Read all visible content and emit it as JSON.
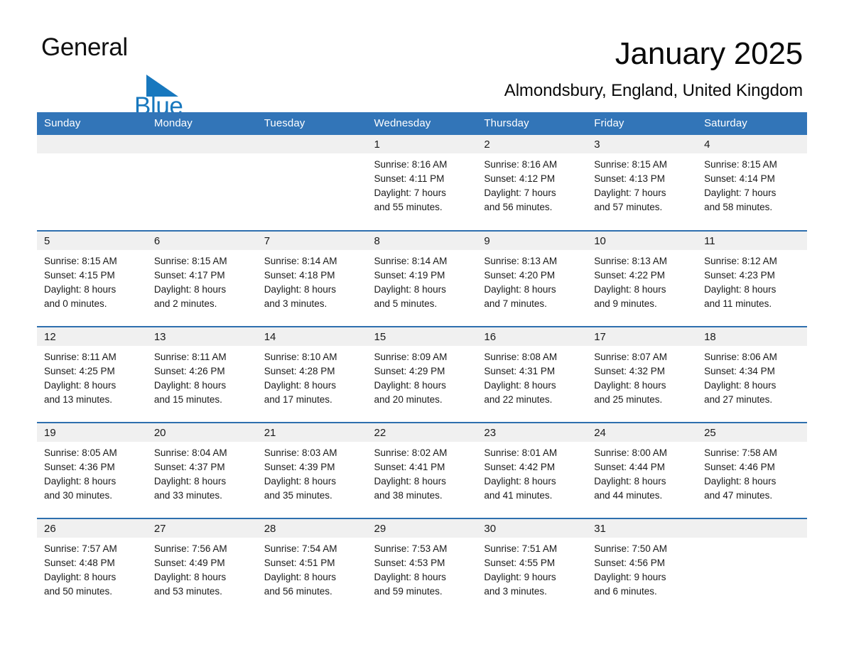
{
  "brand": {
    "name_part1": "General",
    "name_part2": "Blue",
    "triangle_color": "#1878BE",
    "text_color": "#101010"
  },
  "header": {
    "month_title": "January 2025",
    "location": "Almondsbury, England, United Kingdom"
  },
  "theme": {
    "header_blue": "#3275B8",
    "row_divider_blue": "#2E6FAE",
    "daynum_band_gray": "#F0F0F0",
    "text_color": "#1a1a1a"
  },
  "weekday_headers": [
    "Sunday",
    "Monday",
    "Tuesday",
    "Wednesday",
    "Thursday",
    "Friday",
    "Saturday"
  ],
  "weeks": [
    [
      {
        "day": "",
        "blank": true,
        "sunrise": "",
        "sunset": "",
        "daylight_line1": "",
        "daylight_line2": ""
      },
      {
        "day": "",
        "blank": true,
        "sunrise": "",
        "sunset": "",
        "daylight_line1": "",
        "daylight_line2": ""
      },
      {
        "day": "",
        "blank": true,
        "sunrise": "",
        "sunset": "",
        "daylight_line1": "",
        "daylight_line2": ""
      },
      {
        "day": "1",
        "blank": false,
        "sunrise": "Sunrise: 8:16 AM",
        "sunset": "Sunset: 4:11 PM",
        "daylight_line1": "Daylight: 7 hours",
        "daylight_line2": "and 55 minutes."
      },
      {
        "day": "2",
        "blank": false,
        "sunrise": "Sunrise: 8:16 AM",
        "sunset": "Sunset: 4:12 PM",
        "daylight_line1": "Daylight: 7 hours",
        "daylight_line2": "and 56 minutes."
      },
      {
        "day": "3",
        "blank": false,
        "sunrise": "Sunrise: 8:15 AM",
        "sunset": "Sunset: 4:13 PM",
        "daylight_line1": "Daylight: 7 hours",
        "daylight_line2": "and 57 minutes."
      },
      {
        "day": "4",
        "blank": false,
        "sunrise": "Sunrise: 8:15 AM",
        "sunset": "Sunset: 4:14 PM",
        "daylight_line1": "Daylight: 7 hours",
        "daylight_line2": "and 58 minutes."
      }
    ],
    [
      {
        "day": "5",
        "blank": false,
        "sunrise": "Sunrise: 8:15 AM",
        "sunset": "Sunset: 4:15 PM",
        "daylight_line1": "Daylight: 8 hours",
        "daylight_line2": "and 0 minutes."
      },
      {
        "day": "6",
        "blank": false,
        "sunrise": "Sunrise: 8:15 AM",
        "sunset": "Sunset: 4:17 PM",
        "daylight_line1": "Daylight: 8 hours",
        "daylight_line2": "and 2 minutes."
      },
      {
        "day": "7",
        "blank": false,
        "sunrise": "Sunrise: 8:14 AM",
        "sunset": "Sunset: 4:18 PM",
        "daylight_line1": "Daylight: 8 hours",
        "daylight_line2": "and 3 minutes."
      },
      {
        "day": "8",
        "blank": false,
        "sunrise": "Sunrise: 8:14 AM",
        "sunset": "Sunset: 4:19 PM",
        "daylight_line1": "Daylight: 8 hours",
        "daylight_line2": "and 5 minutes."
      },
      {
        "day": "9",
        "blank": false,
        "sunrise": "Sunrise: 8:13 AM",
        "sunset": "Sunset: 4:20 PM",
        "daylight_line1": "Daylight: 8 hours",
        "daylight_line2": "and 7 minutes."
      },
      {
        "day": "10",
        "blank": false,
        "sunrise": "Sunrise: 8:13 AM",
        "sunset": "Sunset: 4:22 PM",
        "daylight_line1": "Daylight: 8 hours",
        "daylight_line2": "and 9 minutes."
      },
      {
        "day": "11",
        "blank": false,
        "sunrise": "Sunrise: 8:12 AM",
        "sunset": "Sunset: 4:23 PM",
        "daylight_line1": "Daylight: 8 hours",
        "daylight_line2": "and 11 minutes."
      }
    ],
    [
      {
        "day": "12",
        "blank": false,
        "sunrise": "Sunrise: 8:11 AM",
        "sunset": "Sunset: 4:25 PM",
        "daylight_line1": "Daylight: 8 hours",
        "daylight_line2": "and 13 minutes."
      },
      {
        "day": "13",
        "blank": false,
        "sunrise": "Sunrise: 8:11 AM",
        "sunset": "Sunset: 4:26 PM",
        "daylight_line1": "Daylight: 8 hours",
        "daylight_line2": "and 15 minutes."
      },
      {
        "day": "14",
        "blank": false,
        "sunrise": "Sunrise: 8:10 AM",
        "sunset": "Sunset: 4:28 PM",
        "daylight_line1": "Daylight: 8 hours",
        "daylight_line2": "and 17 minutes."
      },
      {
        "day": "15",
        "blank": false,
        "sunrise": "Sunrise: 8:09 AM",
        "sunset": "Sunset: 4:29 PM",
        "daylight_line1": "Daylight: 8 hours",
        "daylight_line2": "and 20 minutes."
      },
      {
        "day": "16",
        "blank": false,
        "sunrise": "Sunrise: 8:08 AM",
        "sunset": "Sunset: 4:31 PM",
        "daylight_line1": "Daylight: 8 hours",
        "daylight_line2": "and 22 minutes."
      },
      {
        "day": "17",
        "blank": false,
        "sunrise": "Sunrise: 8:07 AM",
        "sunset": "Sunset: 4:32 PM",
        "daylight_line1": "Daylight: 8 hours",
        "daylight_line2": "and 25 minutes."
      },
      {
        "day": "18",
        "blank": false,
        "sunrise": "Sunrise: 8:06 AM",
        "sunset": "Sunset: 4:34 PM",
        "daylight_line1": "Daylight: 8 hours",
        "daylight_line2": "and 27 minutes."
      }
    ],
    [
      {
        "day": "19",
        "blank": false,
        "sunrise": "Sunrise: 8:05 AM",
        "sunset": "Sunset: 4:36 PM",
        "daylight_line1": "Daylight: 8 hours",
        "daylight_line2": "and 30 minutes."
      },
      {
        "day": "20",
        "blank": false,
        "sunrise": "Sunrise: 8:04 AM",
        "sunset": "Sunset: 4:37 PM",
        "daylight_line1": "Daylight: 8 hours",
        "daylight_line2": "and 33 minutes."
      },
      {
        "day": "21",
        "blank": false,
        "sunrise": "Sunrise: 8:03 AM",
        "sunset": "Sunset: 4:39 PM",
        "daylight_line1": "Daylight: 8 hours",
        "daylight_line2": "and 35 minutes."
      },
      {
        "day": "22",
        "blank": false,
        "sunrise": "Sunrise: 8:02 AM",
        "sunset": "Sunset: 4:41 PM",
        "daylight_line1": "Daylight: 8 hours",
        "daylight_line2": "and 38 minutes."
      },
      {
        "day": "23",
        "blank": false,
        "sunrise": "Sunrise: 8:01 AM",
        "sunset": "Sunset: 4:42 PM",
        "daylight_line1": "Daylight: 8 hours",
        "daylight_line2": "and 41 minutes."
      },
      {
        "day": "24",
        "blank": false,
        "sunrise": "Sunrise: 8:00 AM",
        "sunset": "Sunset: 4:44 PM",
        "daylight_line1": "Daylight: 8 hours",
        "daylight_line2": "and 44 minutes."
      },
      {
        "day": "25",
        "blank": false,
        "sunrise": "Sunrise: 7:58 AM",
        "sunset": "Sunset: 4:46 PM",
        "daylight_line1": "Daylight: 8 hours",
        "daylight_line2": "and 47 minutes."
      }
    ],
    [
      {
        "day": "26",
        "blank": false,
        "sunrise": "Sunrise: 7:57 AM",
        "sunset": "Sunset: 4:48 PM",
        "daylight_line1": "Daylight: 8 hours",
        "daylight_line2": "and 50 minutes."
      },
      {
        "day": "27",
        "blank": false,
        "sunrise": "Sunrise: 7:56 AM",
        "sunset": "Sunset: 4:49 PM",
        "daylight_line1": "Daylight: 8 hours",
        "daylight_line2": "and 53 minutes."
      },
      {
        "day": "28",
        "blank": false,
        "sunrise": "Sunrise: 7:54 AM",
        "sunset": "Sunset: 4:51 PM",
        "daylight_line1": "Daylight: 8 hours",
        "daylight_line2": "and 56 minutes."
      },
      {
        "day": "29",
        "blank": false,
        "sunrise": "Sunrise: 7:53 AM",
        "sunset": "Sunset: 4:53 PM",
        "daylight_line1": "Daylight: 8 hours",
        "daylight_line2": "and 59 minutes."
      },
      {
        "day": "30",
        "blank": false,
        "sunrise": "Sunrise: 7:51 AM",
        "sunset": "Sunset: 4:55 PM",
        "daylight_line1": "Daylight: 9 hours",
        "daylight_line2": "and 3 minutes."
      },
      {
        "day": "31",
        "blank": false,
        "sunrise": "Sunrise: 7:50 AM",
        "sunset": "Sunset: 4:56 PM",
        "daylight_line1": "Daylight: 9 hours",
        "daylight_line2": "and 6 minutes."
      },
      {
        "day": "",
        "blank": true,
        "sunrise": "",
        "sunset": "",
        "daylight_line1": "",
        "daylight_line2": ""
      }
    ]
  ]
}
